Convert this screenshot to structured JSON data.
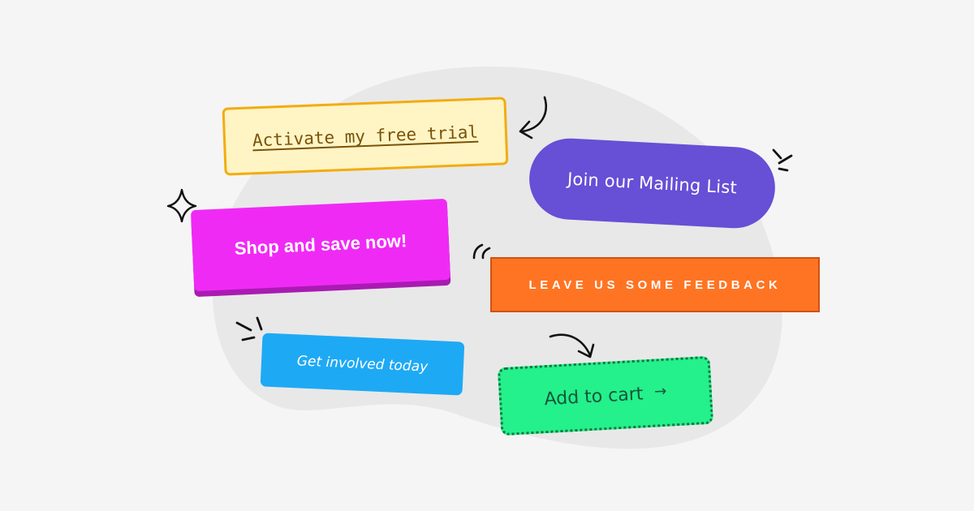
{
  "buttons": {
    "trial": {
      "label": "Activate my free trial",
      "bg": "#fff4c4",
      "border": "#f2ac10",
      "text": "#7a5208"
    },
    "mailing": {
      "label": "Join our Mailing List",
      "bg": "#674fd6",
      "text": "#ffffff"
    },
    "shop": {
      "label": "Shop and save now!",
      "bg": "#f02af5",
      "shadow": "#a91bb2",
      "text": "#ffffff"
    },
    "feedback": {
      "label": "LEAVE US SOME FEEDBACK",
      "bg": "#ff7423",
      "border": "#cf5214",
      "text": "#ffffff"
    },
    "involved": {
      "label": "Get involved today",
      "bg": "#1ea9f5",
      "text": "#ffffff"
    },
    "cart": {
      "label": "Add to cart",
      "arrow_icon": "arrow-right-icon",
      "arrow_glyph": "→",
      "bg": "#24f08c",
      "border": "#13763f",
      "text": "#14553a"
    }
  },
  "decorations": {
    "background_blob": "#e8e8e8",
    "page_background": "#f5f5f5",
    "stroke": "#111111",
    "icons": [
      "curved-arrow-icon",
      "sparkle-icon",
      "burst-lines-icon",
      "swoosh-arcs-icon",
      "curved-arrow-down-icon"
    ]
  }
}
